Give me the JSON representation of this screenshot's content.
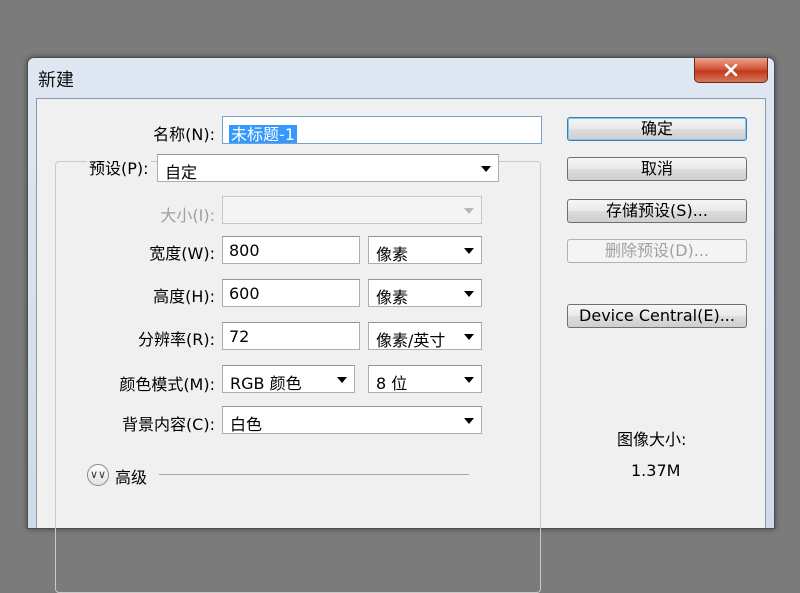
{
  "window": {
    "title": "新建"
  },
  "form": {
    "name_label": "名称(N):",
    "name_value": "未标题-1",
    "preset_label": "预设(P):",
    "preset_value": "自定",
    "size_label": "大小(I):",
    "size_value": "",
    "width_label": "宽度(W):",
    "width_value": "800",
    "width_unit": "像素",
    "height_label": "高度(H):",
    "height_value": "600",
    "height_unit": "像素",
    "resolution_label": "分辨率(R):",
    "resolution_value": "72",
    "resolution_unit": "像素/英寸",
    "color_mode_label": "颜色模式(M):",
    "color_mode_value": "RGB 颜色",
    "bit_depth_value": "8 位",
    "background_label": "背景内容(C):",
    "background_value": "白色",
    "advanced_label": "高级"
  },
  "buttons": {
    "ok": "确定",
    "cancel": "取消",
    "save_preset": "存储预设(S)...",
    "delete_preset": "删除预设(D)...",
    "device_central": "Device Central(E)..."
  },
  "image_size": {
    "label": "图像大小:",
    "value": "1.37M"
  },
  "icons": {
    "close": "close-icon",
    "expand": "double-chevron-down-icon",
    "dropdown": "chevron-down-icon"
  },
  "colors": {
    "selection": "#3399ff",
    "close_button": "#c23a1d",
    "title_bar": "#dfe8f2"
  }
}
